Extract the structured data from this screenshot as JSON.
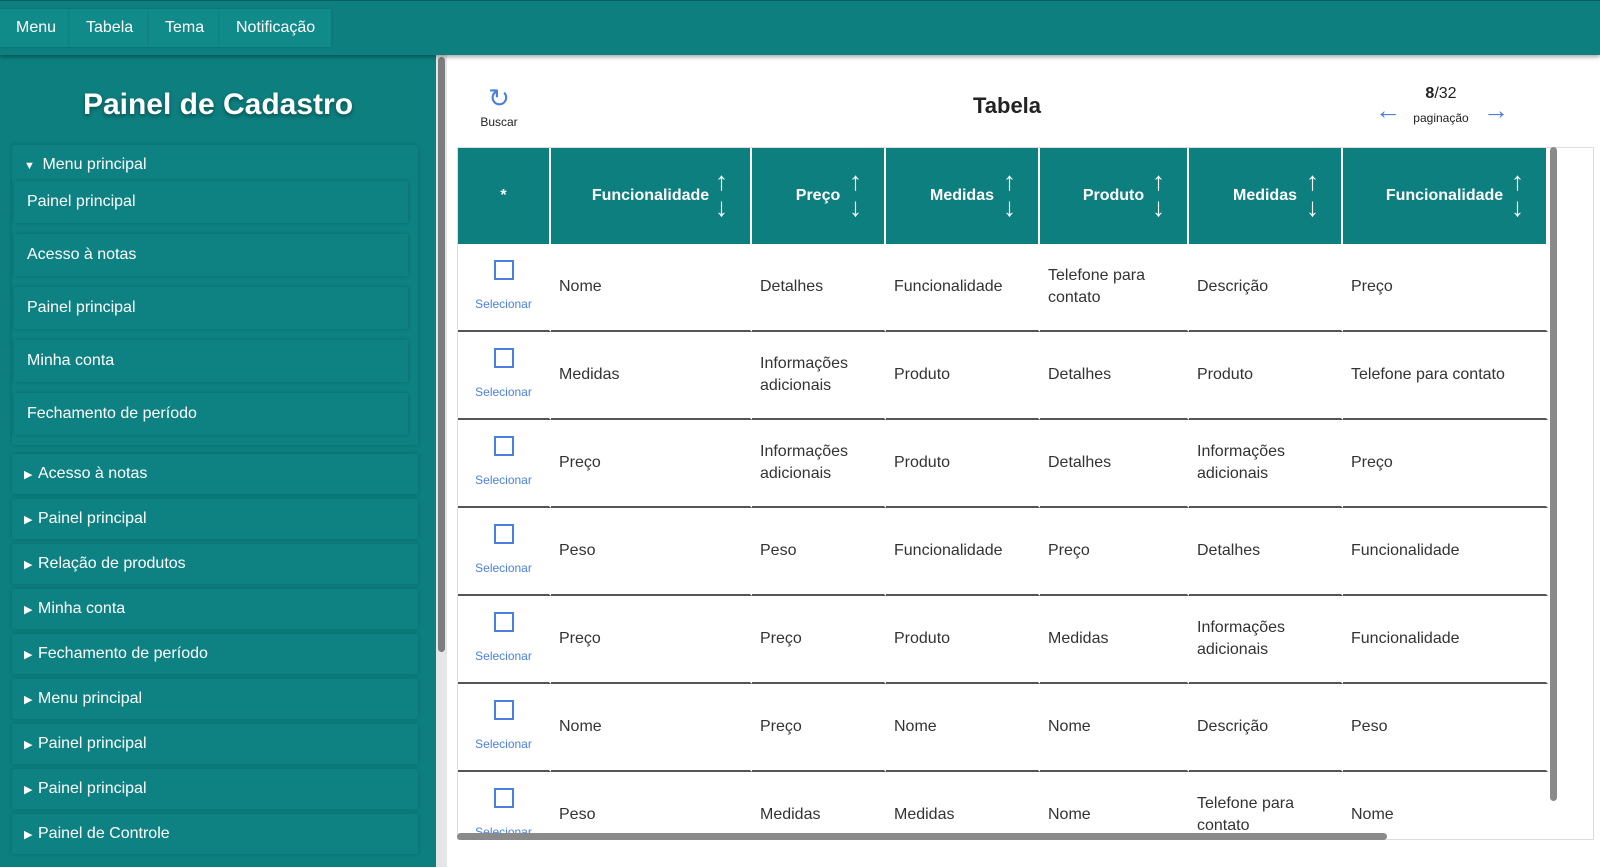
{
  "topnav": [
    "Menu",
    "Tabela",
    "Tema",
    "Notificação"
  ],
  "sidebar": {
    "title": "Painel de Cadastro",
    "expanded_group": {
      "label": "Menu principal",
      "items": [
        "Painel principal",
        "Acesso à notas",
        "Painel principal",
        "Minha conta",
        "Fechamento de período"
      ]
    },
    "groups": [
      "Acesso à notas",
      "Painel principal",
      "Relação de produtos",
      "Minha conta",
      "Fechamento de período",
      "Menu principal",
      "Painel principal",
      "Painel principal",
      "Painel de Controle"
    ]
  },
  "main": {
    "refresh_label": "Buscar",
    "title": "Tabela",
    "pagination": {
      "current": "8",
      "total": "/32",
      "label": "paginação"
    }
  },
  "table": {
    "select_header": "*",
    "select_label": "Selecionar",
    "headers": [
      "Funcionalidade",
      "Preço",
      "Medidas",
      "Produto",
      "Medidas",
      "Funcionalidade"
    ],
    "rows": [
      [
        "Nome",
        "Detalhes",
        "Funcionalidade",
        "Telefone para contato",
        "Descrição",
        "Preço"
      ],
      [
        "Medidas",
        "Informações adicionais",
        "Produto",
        "Detalhes",
        "Produto",
        "Telefone para contato"
      ],
      [
        "Preço",
        "Informações adicionais",
        "Produto",
        "Detalhes",
        "Informações adicionais",
        "Preço"
      ],
      [
        "Peso",
        "Peso",
        "Funcionalidade",
        "Preço",
        "Detalhes",
        "Funcionalidade"
      ],
      [
        "Preço",
        "Preço",
        "Produto",
        "Medidas",
        "Informações adicionais",
        "Funcionalidade"
      ],
      [
        "Nome",
        "Preço",
        "Nome",
        "Nome",
        "Descrição",
        "Peso"
      ],
      [
        "Peso",
        "Medidas",
        "Medidas",
        "Nome",
        "Telefone para contato",
        "Nome"
      ]
    ]
  }
}
